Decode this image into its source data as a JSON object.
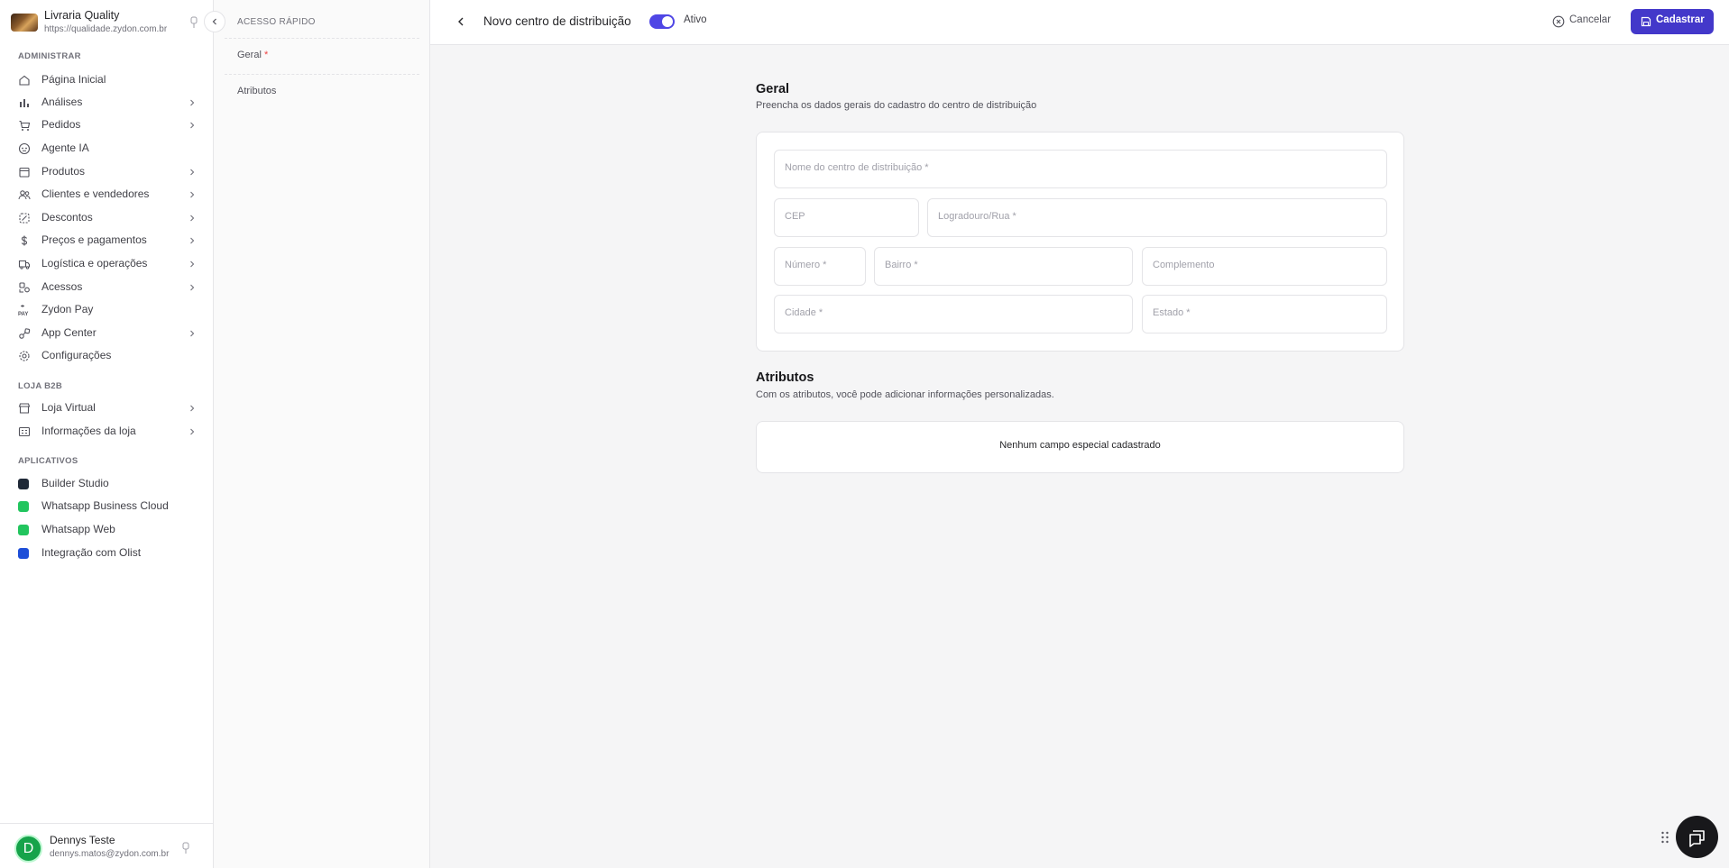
{
  "store": {
    "name": "Livraria Quality",
    "url": "https://qualidade.zydon.com.br"
  },
  "sidebar": {
    "sections": [
      "ADMINISTRAR",
      "LOJA B2B",
      "APLICATIVOS"
    ],
    "admin_items": [
      {
        "label": "Página Inicial",
        "icon": "home-icon"
      },
      {
        "label": "Análises",
        "icon": "chart-icon"
      },
      {
        "label": "Pedidos",
        "icon": "cart-icon"
      },
      {
        "label": "Agente IA",
        "icon": "robot-icon"
      },
      {
        "label": "Produtos",
        "icon": "box-icon"
      },
      {
        "label": "Clientes e vendedores",
        "icon": "users-icon"
      },
      {
        "label": "Descontos",
        "icon": "discount-icon"
      },
      {
        "label": "Preços e pagamentos",
        "icon": "dollar-icon"
      },
      {
        "label": "Logística e operações",
        "icon": "truck-icon"
      },
      {
        "label": "Acessos",
        "icon": "access-icon"
      },
      {
        "label": "Zydon Pay",
        "icon": "pay-icon"
      },
      {
        "label": "App Center",
        "icon": "puzzle-icon"
      },
      {
        "label": "Configurações",
        "icon": "gear-icon"
      }
    ],
    "b2b_items": [
      {
        "label": "Loja Virtual",
        "icon": "store-icon"
      },
      {
        "label": "Informações da loja",
        "icon": "info-card-icon"
      }
    ],
    "app_items": [
      {
        "label": "Builder Studio",
        "color": "#1f2937"
      },
      {
        "label": "Whatsapp Business Cloud",
        "color": "#22c55e"
      },
      {
        "label": "Whatsapp Web",
        "color": "#22c55e"
      },
      {
        "label": "Integração com Olist",
        "color": "#1d4ed8"
      }
    ]
  },
  "user": {
    "initial": "D",
    "name": "Dennys Teste",
    "email": "dennys.matos@zydon.com.br"
  },
  "quick_access": {
    "title": "ACESSO RÁPIDO",
    "items": [
      {
        "label": "Geral",
        "required_mark": "*"
      },
      {
        "label": "Atributos"
      }
    ]
  },
  "header": {
    "title": "Novo centro de distribuição",
    "toggle_label": "Ativo",
    "toggle_on": true,
    "cancel_label": "Cancelar",
    "submit_label": "Cadastrar",
    "accent_color": "#4338ca"
  },
  "general": {
    "title": "Geral",
    "subtitle": "Preencha os dados gerais do cadastro do centro de distribuição",
    "fields": {
      "name": "Nome do centro de distribuição *",
      "cep": "CEP",
      "street": "Logradouro/Rua *",
      "number": "Número *",
      "district": "Bairro *",
      "complement": "Complemento",
      "city": "Cidade *",
      "state": "Estado *"
    }
  },
  "attributes": {
    "title": "Atributos",
    "subtitle": "Com os atributos, você pode adicionar informações personalizadas.",
    "empty_text": "Nenhum campo especial cadastrado"
  },
  "widgets": {
    "chat_icon": "chat-icon",
    "drag_icon": "grip-icon"
  }
}
